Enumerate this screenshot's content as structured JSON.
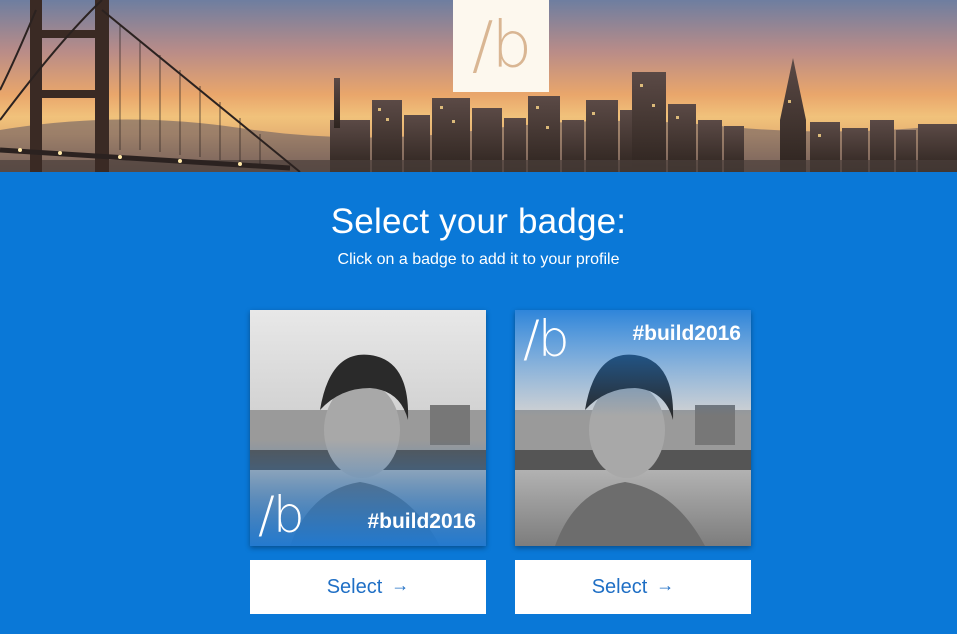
{
  "header": {
    "logo_text": "/b",
    "background": "san-francisco-skyline-bay-bridge-sunset"
  },
  "main": {
    "title": "Select your badge:",
    "subtitle": "Click on a badge to add it to your profile"
  },
  "badges": [
    {
      "logo_text": "/b",
      "hashtag": "#build2016",
      "select_label": "Select",
      "arrow_icon": "→"
    },
    {
      "logo_text": "/b",
      "hashtag": "#build2016",
      "select_label": "Select",
      "arrow_icon": "→"
    }
  ],
  "colors": {
    "background": "#0a78d7",
    "button_text": "#1f6fc5",
    "logo_text": "#d9b693",
    "logo_background": "#fdf8ee"
  }
}
